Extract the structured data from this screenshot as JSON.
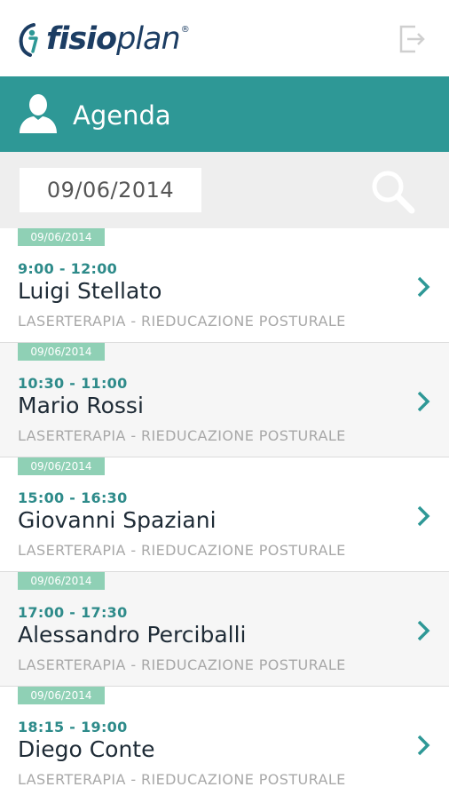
{
  "app": {
    "logo_bold": "fisio",
    "logo_light": "plan",
    "logo_mark": "®"
  },
  "header": {
    "title": "Agenda",
    "user_icon": "person-icon",
    "background": "#2e9896"
  },
  "search": {
    "date_value": "09/06/2014",
    "icon": "search-icon"
  },
  "colors": {
    "accent": "#2e9896",
    "badge": "#8fd0b5",
    "time_text": "#2e8b8a",
    "brand": "#1c3d63"
  },
  "appointments": [
    {
      "date": "09/06/2014",
      "time": "9:00 - 12:00",
      "name": "Luigi Stellato",
      "treatment": "LASERTERAPIA - RIEDUCAZIONE POSTURALE"
    },
    {
      "date": "09/06/2014",
      "time": "10:30 - 11:00",
      "name": "Mario Rossi",
      "treatment": "LASERTERAPIA - RIEDUCAZIONE POSTURALE"
    },
    {
      "date": "09/06/2014",
      "time": "15:00 - 16:30",
      "name": "Giovanni Spaziani",
      "treatment": "LASERTERAPIA - RIEDUCAZIONE POSTURALE"
    },
    {
      "date": "09/06/2014",
      "time": "17:00 - 17:30",
      "name": "Alessandro Perciballi",
      "treatment": "LASERTERAPIA - RIEDUCAZIONE POSTURALE"
    },
    {
      "date": "09/06/2014",
      "time": "18:15 - 19:00",
      "name": "Diego Conte",
      "treatment": "LASERTERAPIA - RIEDUCAZIONE POSTURALE"
    }
  ]
}
